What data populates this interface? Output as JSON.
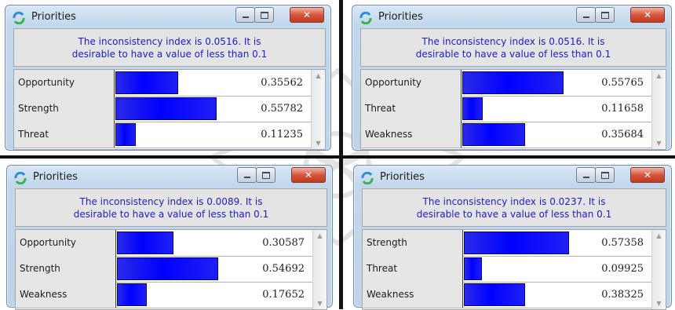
{
  "windows": [
    {
      "title": "Priorities",
      "message": [
        "The inconsistency index is 0.0516.  It is",
        "desirable to have a value of less than  0.1"
      ],
      "rows": [
        {
          "label": "Opportunity",
          "value": "0.35562"
        },
        {
          "label": "Strength",
          "value": "0.55782"
        },
        {
          "label": "Threat",
          "value": "0.11235"
        }
      ]
    },
    {
      "title": "Priorities",
      "message": [
        "The inconsistency index is 0.0516.  It is",
        "desirable to have a value of less than  0.1"
      ],
      "rows": [
        {
          "label": "Opportunity",
          "value": "0.55765"
        },
        {
          "label": "Threat",
          "value": "0.11658"
        },
        {
          "label": "Weakness",
          "value": "0.35684"
        }
      ]
    },
    {
      "title": "Priorities",
      "message": [
        "The inconsistency index is 0.0089.  It is",
        "desirable to have a value of less than  0.1"
      ],
      "rows": [
        {
          "label": "Opportunity",
          "value": "0.30587"
        },
        {
          "label": "Strength",
          "value": "0.54692"
        },
        {
          "label": "Weakness",
          "value": "0.17652"
        }
      ]
    },
    {
      "title": "Priorities",
      "message": [
        "The inconsistency index is 0.0237.  It is",
        "desirable to have a value of less than  0.1"
      ],
      "rows": [
        {
          "label": "Strength",
          "value": "0.57358"
        },
        {
          "label": "Threat",
          "value": "0.09925"
        },
        {
          "label": "Weakness",
          "value": "0.38325"
        }
      ]
    }
  ],
  "colors": {
    "bar": "#0000ff",
    "message_text": "#1c1cc8"
  }
}
